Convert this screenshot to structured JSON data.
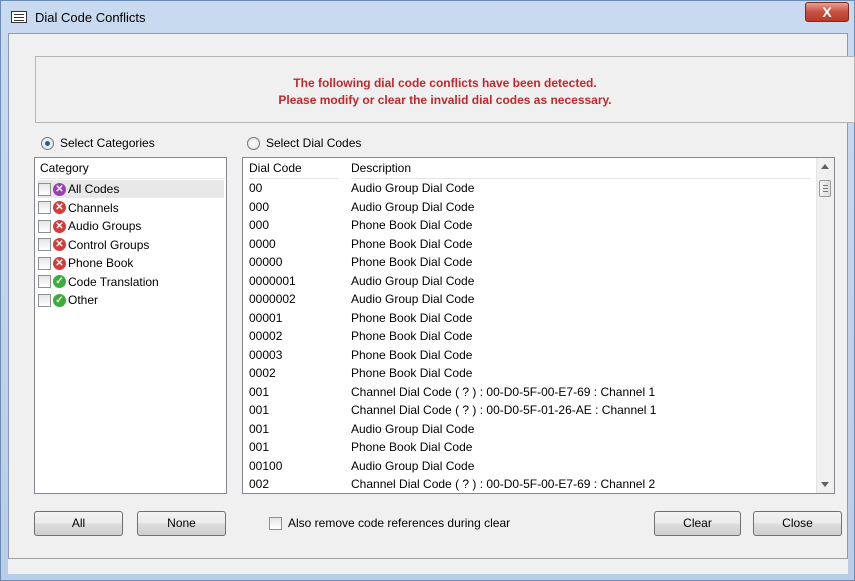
{
  "window": {
    "title": "Dial Code Conflicts",
    "close_glyph": "X"
  },
  "banner": {
    "line1": "The following dial code conflicts have been detected.",
    "line2": "Please modify or clear the invalid dial codes as necessary."
  },
  "mode": {
    "select_categories_label": "Select Categories",
    "select_dial_codes_label": "Select Dial Codes",
    "selected": "Select Categories"
  },
  "categories": {
    "header": "Category",
    "items": [
      {
        "label": "All Codes",
        "status": "conflict-selected"
      },
      {
        "label": "Channels",
        "status": "conflict"
      },
      {
        "label": "Audio Groups",
        "status": "conflict"
      },
      {
        "label": "Control Groups",
        "status": "conflict"
      },
      {
        "label": "Phone Book",
        "status": "conflict"
      },
      {
        "label": "Code Translation",
        "status": "ok"
      },
      {
        "label": "Other",
        "status": "ok"
      }
    ]
  },
  "codes": {
    "headers": [
      "Dial Code",
      "Description"
    ],
    "rows": [
      [
        "00",
        "Audio Group Dial Code"
      ],
      [
        "000",
        "Audio Group Dial Code"
      ],
      [
        "000",
        "Phone Book Dial Code"
      ],
      [
        "0000",
        "Phone Book Dial Code"
      ],
      [
        "00000",
        "Phone Book Dial Code"
      ],
      [
        "0000001",
        "Audio Group Dial Code"
      ],
      [
        "0000002",
        "Audio Group Dial Code"
      ],
      [
        "00001",
        "Phone Book Dial Code"
      ],
      [
        "00002",
        "Phone Book Dial Code"
      ],
      [
        "00003",
        "Phone Book Dial Code"
      ],
      [
        "0002",
        "Phone Book Dial Code"
      ],
      [
        "001",
        "Channel Dial Code ( ? ) : 00-D0-5F-00-E7-69 : Channel 1"
      ],
      [
        "001",
        "Channel Dial Code ( ? ) : 00-D0-5F-01-26-AE : Channel 1"
      ],
      [
        "001",
        "Audio Group Dial Code"
      ],
      [
        "001",
        "Phone Book Dial Code"
      ],
      [
        "00100",
        "Audio Group Dial Code"
      ],
      [
        "002",
        "Channel Dial Code ( ? ) : 00-D0-5F-00-E7-69 : Channel 2"
      ]
    ]
  },
  "buttons": {
    "all": "All",
    "none": "None",
    "clear": "Clear",
    "close": "Close"
  },
  "options": {
    "remove_refs_label": "Also remove code references during clear"
  },
  "icons": {
    "conflict": "x-circle-icon",
    "ok": "check-circle-icon"
  }
}
